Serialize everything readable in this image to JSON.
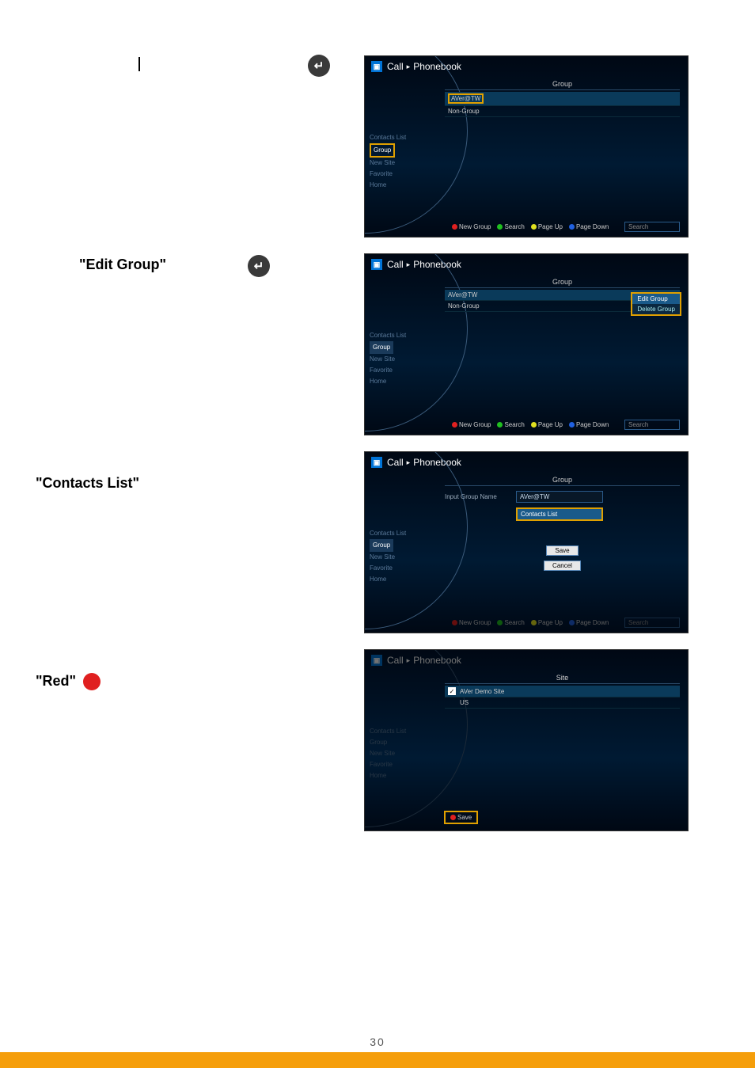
{
  "page_number": "30",
  "steps": {
    "step1_prefix": "",
    "enter_symbol": "↵",
    "step2_label": "\"Edit Group\"",
    "step3_label": "\"Contacts List\"",
    "step4_label": "\"Red\""
  },
  "common": {
    "breadcrumb_a": "Call",
    "breadcrumb_b": "Phonebook",
    "nav": {
      "contacts": "Contacts List",
      "group": "Group",
      "newsite": "New Site",
      "favorite": "Favorite",
      "home": "Home"
    },
    "footer": {
      "newgroup": "New Group",
      "search": "Search",
      "pageup": "Page Up",
      "pagedown": "Page Down",
      "search_label": "Search"
    }
  },
  "shot1": {
    "panel_title": "Group",
    "rows": {
      "r1": "AVer@TW",
      "r2": "Non-Group"
    }
  },
  "shot2": {
    "panel_title": "Group",
    "rows": {
      "r1": "AVer@TW",
      "r2": "Non-Group"
    },
    "ctx": {
      "edit": "Edit Group",
      "del": "Delete Group"
    }
  },
  "shot3": {
    "panel_title": "Group",
    "label": "Input Group Name",
    "value": "AVer@TW",
    "contacts_btn": "Contacts List",
    "save": "Save",
    "cancel": "Cancel"
  },
  "shot4": {
    "panel_title": "Site",
    "rows": {
      "r1": "AVer Demo Site",
      "r2": "US"
    },
    "save": "Save"
  }
}
